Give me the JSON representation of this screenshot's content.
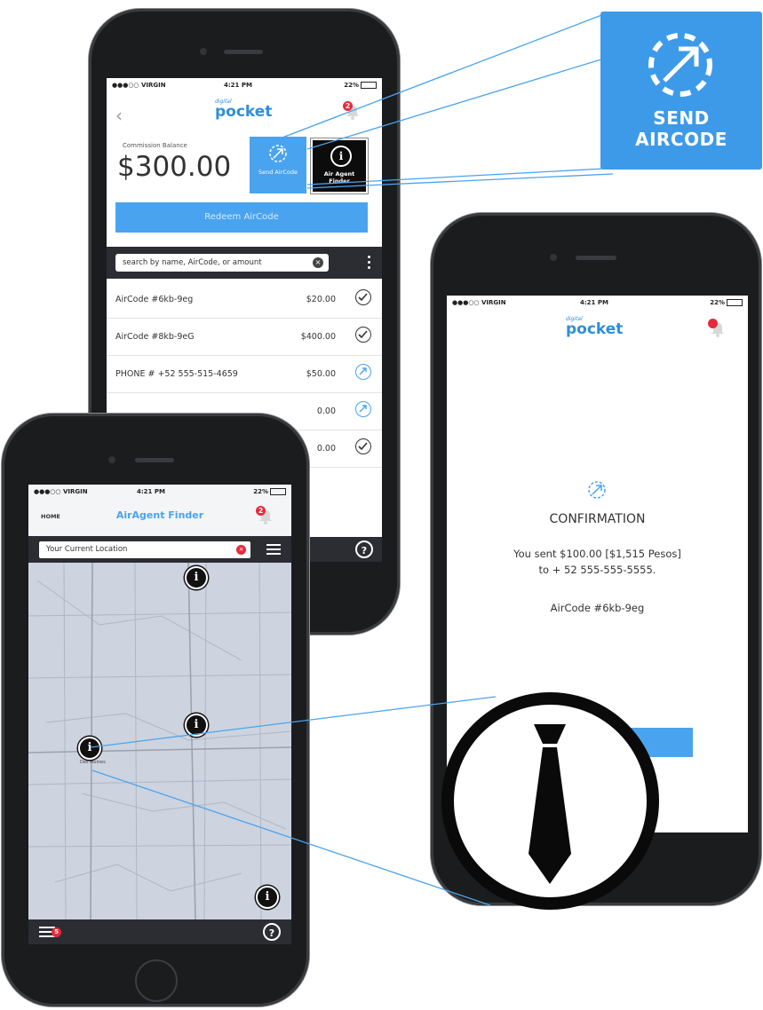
{
  "phone1": {
    "status": {
      "carrier": "●●●○○ VIRGIN",
      "time": "4:21 PM",
      "battery": "22%"
    },
    "logo": {
      "small": "digital",
      "big": "pocket"
    },
    "notification_count": "2",
    "balance_label": "Commission Balance",
    "balance_value": "$300.00",
    "send_aircode_label": "Send AirCode",
    "air_agent_finder_label": "Air Agent Finder",
    "redeem_label": "Redeem AirCode",
    "search_placeholder": "search by name, AirCode, or amount",
    "transactions": [
      {
        "title": "AirCode #6kb-9eg",
        "amount": "$20.00",
        "status": "redeemed"
      },
      {
        "title": "AirCode #8kb-9eG",
        "amount": "$400.00",
        "status": "redeemed"
      },
      {
        "title": "PHONE # +52 555-515-4659",
        "amount": "$50.00",
        "status": "sent"
      },
      {
        "title": "",
        "amount": "0.00",
        "status": "sent"
      },
      {
        "title": "",
        "amount": "0.00",
        "status": "redeemed"
      }
    ],
    "help": "?"
  },
  "callout_send": {
    "line1": "SEND",
    "line2": "AIRCODE"
  },
  "phone2": {
    "status": {
      "carrier": "●●●○○ VIRGIN",
      "time": "4:21 PM",
      "battery": "22%"
    },
    "logo": {
      "small": "digital",
      "big": "pocket"
    },
    "confirmation_title": "CONFIRMATION",
    "message_line1": "You sent $100.00 [$1,515 Pesos]",
    "message_line2": "to + 52 555-555-5555.",
    "aircode": "AirCode #6kb-9eg"
  },
  "phone3": {
    "status": {
      "carrier": "●●●○○ VIRGIN",
      "time": "4:21 PM",
      "battery": "22%"
    },
    "nav_home": "HOME",
    "title": "AirAgent Finder",
    "notification_count": "2",
    "location_value": "Your Current Location",
    "menu_badge": "5",
    "help": "?",
    "map_town": "Des Moines"
  },
  "colors": {
    "accent": "#4aa3ee",
    "callout": "#3d9ae8",
    "dark_bar": "#2b2d33",
    "alert": "#e52a3a"
  }
}
